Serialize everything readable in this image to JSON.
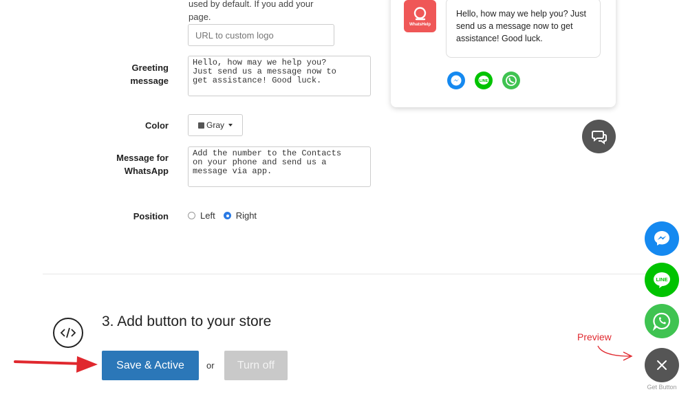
{
  "form": {
    "logo_help_text": "used by default. If you add your page.",
    "logo_help_line1": "used by default. If you add your",
    "logo_help_line2": "page.",
    "logo_placeholder": "URL to custom logo",
    "greeting_label_1": "Greeting",
    "greeting_label_2": "message",
    "greeting_value": "Hello, how may we help you?\nJust send us a message now to\nget assistance! Good luck.",
    "color_label": "Color",
    "color_value": "Gray",
    "whatsapp_label_1": "Message for",
    "whatsapp_label_2": "WhatsApp",
    "whatsapp_value": "Add the number to the Contacts\non your phone and send us a\nmessage via app.",
    "position_label": "Position",
    "position_left": "Left",
    "position_right": "Right",
    "position_selected": "Right"
  },
  "preview_widget": {
    "logo_text": "WhatsHelp",
    "greeting": "Hello, how may we help you? Just send us a message now to get assistance! Good luck.",
    "channels": [
      "messenger-icon",
      "line-icon",
      "whatsapp-icon"
    ]
  },
  "step3": {
    "title": "3. Add button to your store",
    "save_label": "Save & Active",
    "or_label": "or",
    "turn_off_label": "Turn off"
  },
  "floating": {
    "preview_label": "Preview",
    "get_button_label": "Get Button",
    "messenger_label": "",
    "line_label": "LINE"
  },
  "colors": {
    "messenger": "#1589f0",
    "line": "#00c300",
    "whatsapp": "#3fc351",
    "gray": "#555555",
    "primary": "#2b77b8",
    "accent_red": "#e0282e"
  }
}
